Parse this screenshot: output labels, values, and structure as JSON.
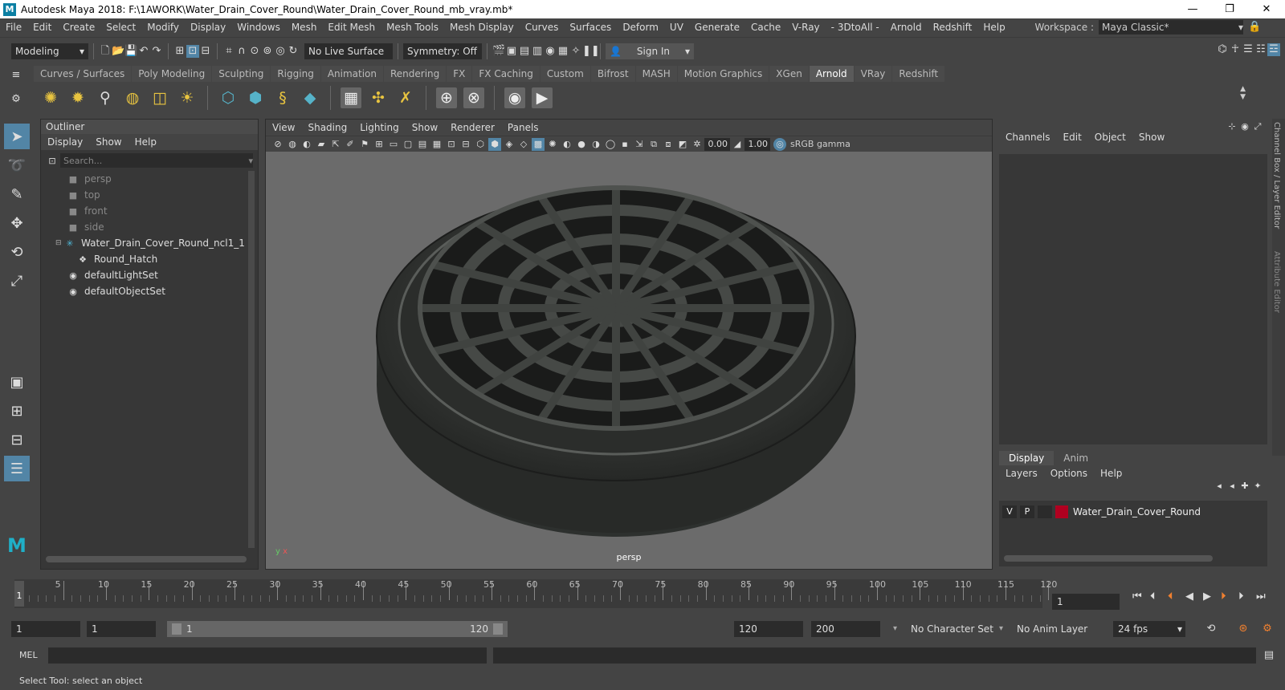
{
  "window": {
    "title": "Autodesk Maya 2018: F:\\1AWORK\\Water_Drain_Cover_Round\\Water_Drain_Cover_Round_mb_vray.mb*",
    "logo": "M",
    "minimize": "—",
    "restore": "❐",
    "close": "✕"
  },
  "menubar": {
    "items": [
      "File",
      "Edit",
      "Create",
      "Select",
      "Modify",
      "Display",
      "Windows",
      "Mesh",
      "Edit Mesh",
      "Mesh Tools",
      "Mesh Display",
      "Curves",
      "Surfaces",
      "Deform",
      "UV",
      "Generate",
      "Cache",
      "V-Ray",
      "- 3DtoAll -",
      "Arnold",
      "Redshift",
      "Help"
    ],
    "workspace_label": "Workspace :",
    "workspace_value": "Maya Classic*"
  },
  "statusline": {
    "mode": "Modeling",
    "live_surface": "No Live Surface",
    "symmetry": "Symmetry: Off",
    "sign_in": "Sign In"
  },
  "shelf": {
    "tabs": [
      "Curves / Surfaces",
      "Poly Modeling",
      "Sculpting",
      "Rigging",
      "Animation",
      "Rendering",
      "FX",
      "FX Caching",
      "Custom",
      "Bifrost",
      "MASH",
      "Motion Graphics",
      "XGen",
      "Arnold",
      "VRay",
      "Redshift"
    ],
    "active_tab": "Arnold"
  },
  "outliner": {
    "title": "Outliner",
    "menu": [
      "Display",
      "Show",
      "Help"
    ],
    "search_placeholder": "Search...",
    "items": [
      {
        "label": "persp",
        "icon": "camera-icon",
        "dim": true,
        "indent": 1
      },
      {
        "label": "top",
        "icon": "camera-icon",
        "dim": true,
        "indent": 1
      },
      {
        "label": "front",
        "icon": "camera-icon",
        "dim": true,
        "indent": 1
      },
      {
        "label": "side",
        "icon": "camera-icon",
        "dim": true,
        "indent": 1
      },
      {
        "label": "Water_Drain_Cover_Round_ncl1_1",
        "icon": "group-icon",
        "dim": false,
        "indent": 1
      },
      {
        "label": "Round_Hatch",
        "icon": "mesh-icon",
        "dim": false,
        "indent": 2
      },
      {
        "label": "defaultLightSet",
        "icon": "set-icon",
        "dim": false,
        "indent": 1
      },
      {
        "label": "defaultObjectSet",
        "icon": "set-icon",
        "dim": false,
        "indent": 1
      }
    ]
  },
  "viewport": {
    "menu": [
      "View",
      "Shading",
      "Lighting",
      "Show",
      "Renderer",
      "Panels"
    ],
    "exposure": "0.00",
    "gamma": "1.00",
    "color_space": "sRGB gamma",
    "camera": "persp"
  },
  "channelbox": {
    "menu": [
      "Channels",
      "Edit",
      "Object",
      "Show"
    ]
  },
  "layereditor": {
    "tabs": [
      "Display",
      "Anim"
    ],
    "menu": [
      "Layers",
      "Options",
      "Help"
    ],
    "layer": {
      "v": "V",
      "p": "P",
      "name": "Water_Drain_Cover_Round",
      "color": "#b00020"
    }
  },
  "sidetabs": [
    "Channel Box / Layer Editor",
    "Attribute Editor"
  ],
  "timeslider": {
    "ticks": [
      "5",
      "10",
      "15",
      "20",
      "25",
      "30",
      "35",
      "40",
      "45",
      "50",
      "55",
      "60",
      "65",
      "70",
      "75",
      "80",
      "85",
      "90",
      "95",
      "100",
      "105",
      "110",
      "115",
      "120"
    ],
    "current_frame": "1",
    "frame_field": "1"
  },
  "rangebar": {
    "start_time": "1",
    "playback_start": "1",
    "range_start": "1",
    "range_end": "120",
    "playback_end": "120",
    "end_time": "200",
    "character_set": "No Character Set",
    "anim_layer": "No Anim Layer",
    "fps": "24 fps"
  },
  "cmdline": {
    "label": "MEL"
  },
  "helpline": {
    "text": "Select Tool: select an object"
  },
  "colors": {
    "accent": "#5285a6",
    "layer_color": "#b00020"
  }
}
